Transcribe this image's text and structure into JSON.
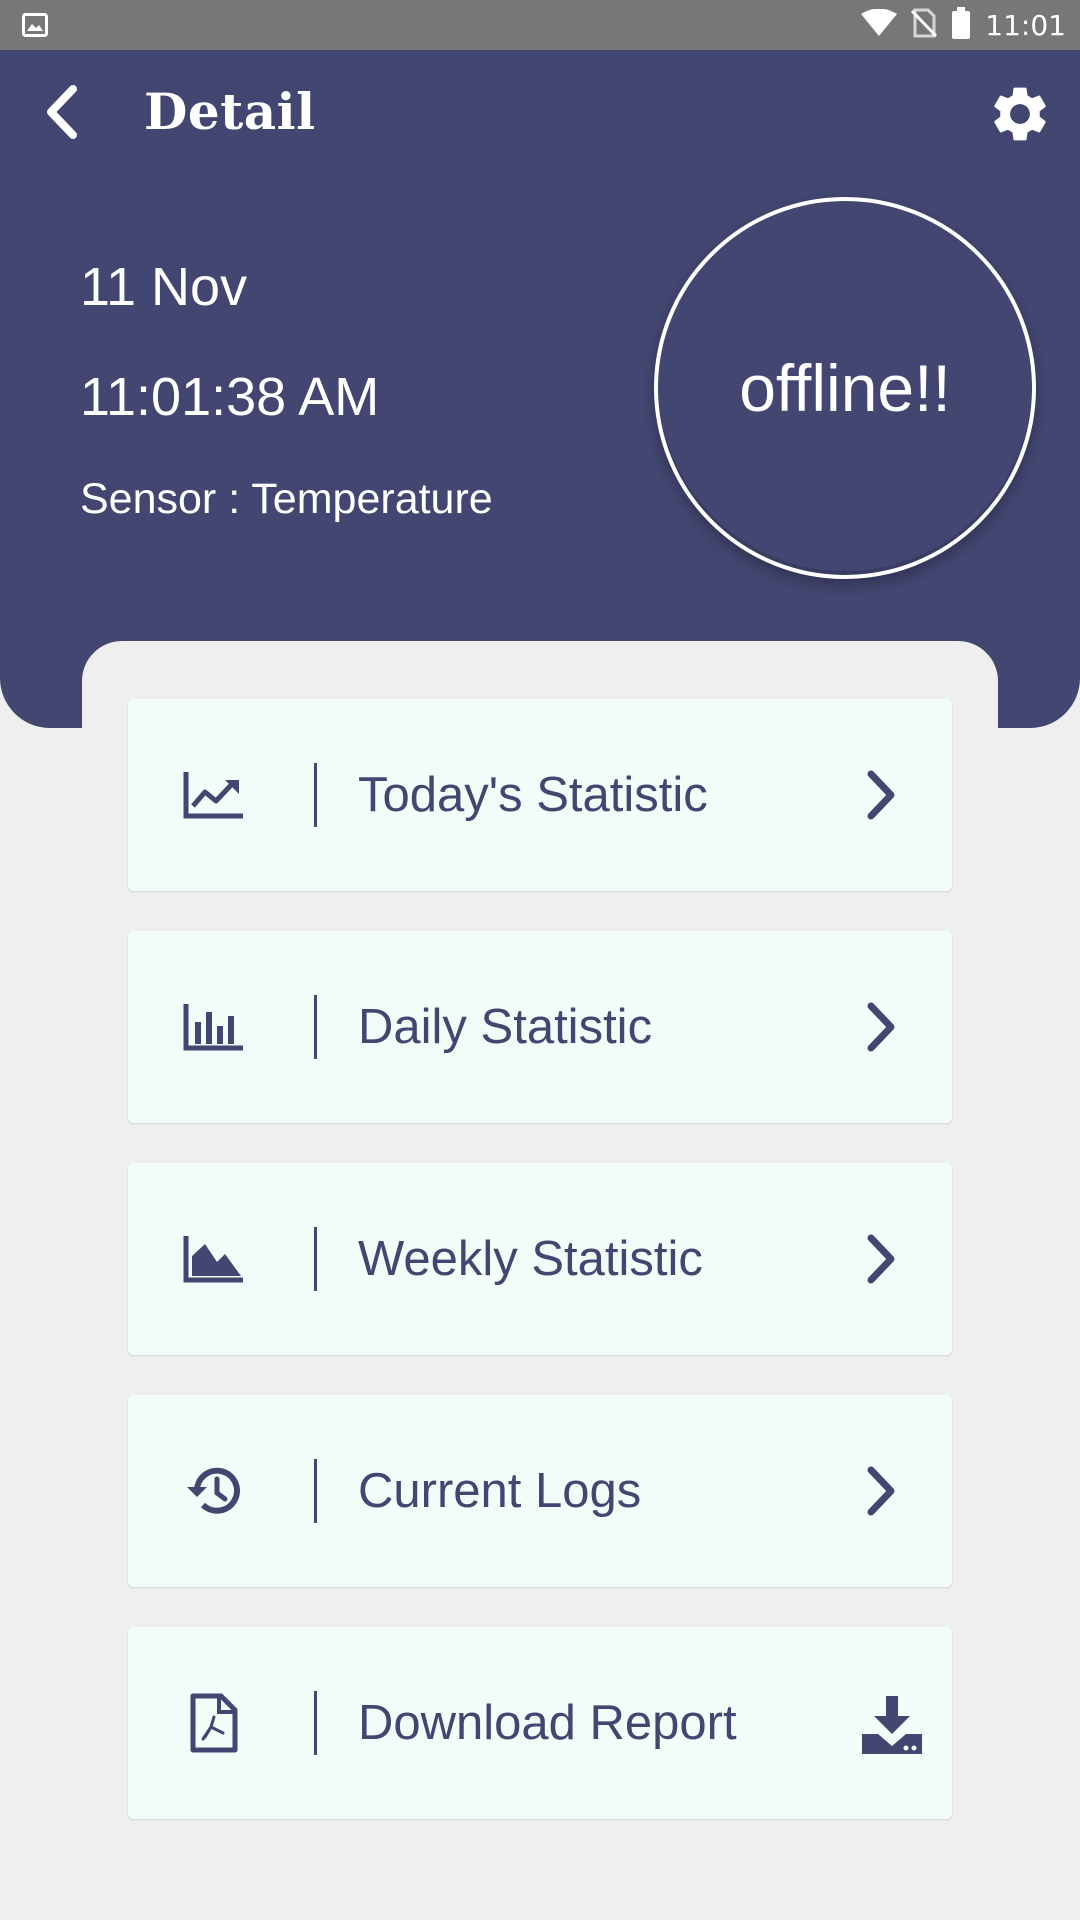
{
  "status_bar": {
    "time": "11:01",
    "icons": [
      "gallery-icon",
      "wifi-icon",
      "no-sim-icon",
      "battery-icon"
    ]
  },
  "header": {
    "title": "Detail",
    "back_icon": "back-arrow-icon",
    "settings_icon": "gear-icon",
    "date": "11 Nov",
    "time": "11:01:38 AM",
    "sensor": "Sensor : Temperature",
    "status": "offline!!"
  },
  "menu": {
    "items": [
      {
        "label": "Today's Statistic",
        "icon": "trending-chart-icon",
        "action_icon": "chevron-right-icon"
      },
      {
        "label": "Daily Statistic",
        "icon": "bar-chart-icon",
        "action_icon": "chevron-right-icon"
      },
      {
        "label": "Weekly Statistic",
        "icon": "area-chart-icon",
        "action_icon": "chevron-right-icon"
      },
      {
        "label": "Current Logs",
        "icon": "history-icon",
        "action_icon": "chevron-right-icon"
      },
      {
        "label": "Download Report",
        "icon": "pdf-file-icon",
        "action_icon": "download-icon"
      }
    ]
  },
  "colors": {
    "primary": "#424670",
    "card_background": "#f2fcf8",
    "page_background": "#efefef",
    "status_bar": "#777777",
    "text_light": "#ffffff"
  }
}
